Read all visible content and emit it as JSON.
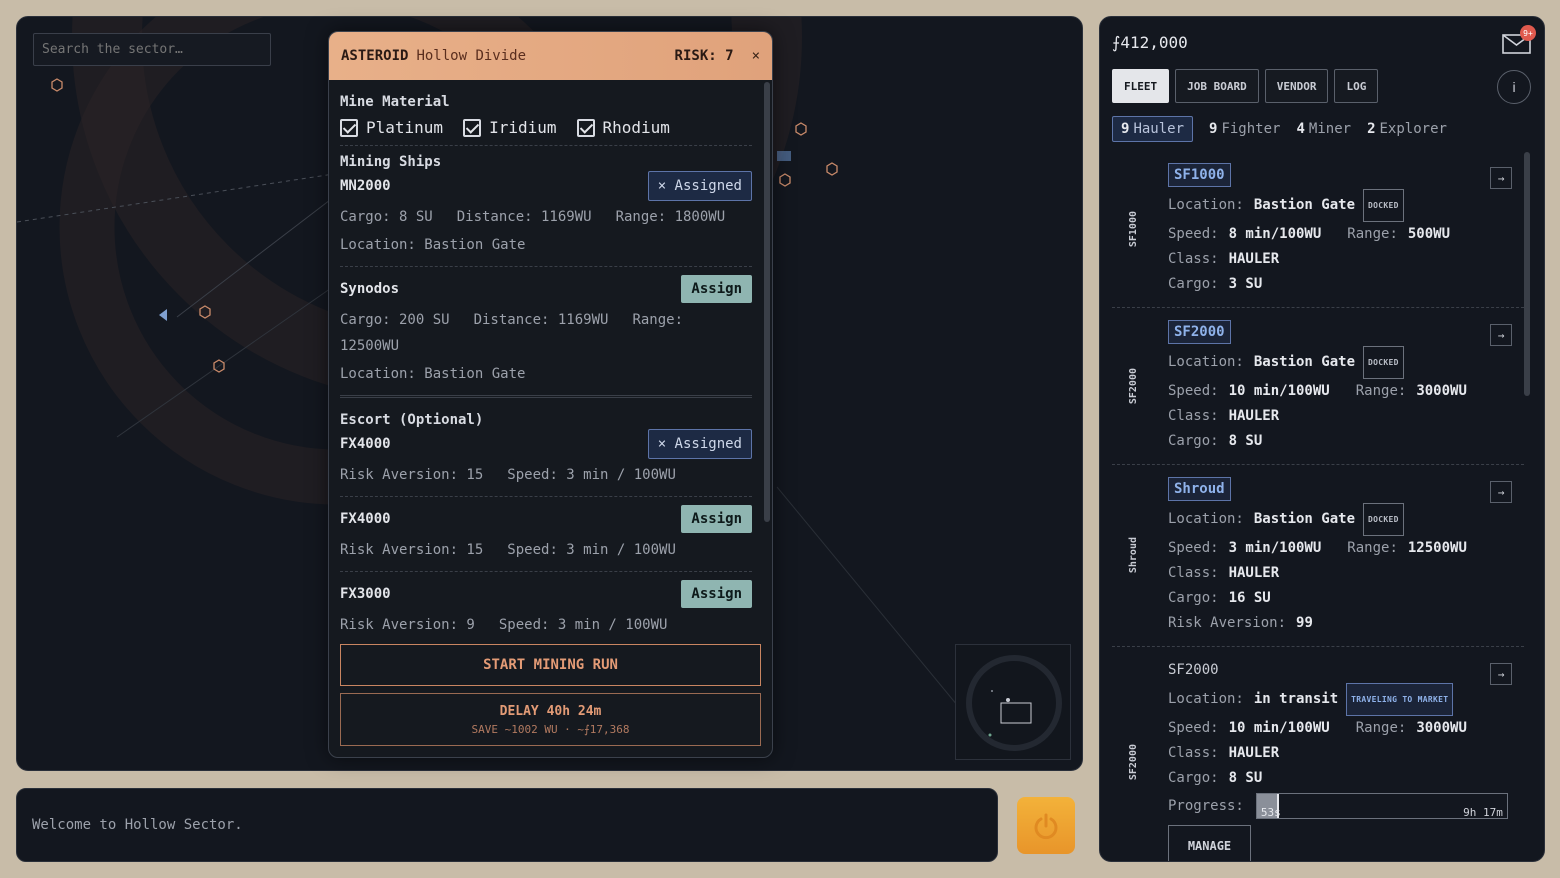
{
  "map": {
    "search_placeholder": "Search the sector…"
  },
  "modal": {
    "kind": "ASTEROID",
    "name": "Hollow Divide",
    "risk_label": "RISK:",
    "risk_value": "7",
    "close_glyph": "×",
    "mine_material_title": "Mine Material",
    "materials": [
      {
        "label": "Platinum",
        "checked": true
      },
      {
        "label": "Iridium",
        "checked": true
      },
      {
        "label": "Rhodium",
        "checked": true
      }
    ],
    "mining_ships_title": "Mining Ships",
    "mining_ships": [
      {
        "name": "MN2000",
        "button": "× Assigned",
        "assigned": true,
        "cargo": "Cargo: 8 SU",
        "distance": "Distance: 1169WU",
        "range": "Range: 1800WU",
        "location": "Location: Bastion Gate"
      },
      {
        "name": "Synodos",
        "button": "Assign",
        "assigned": false,
        "cargo": "Cargo: 200 SU",
        "distance": "Distance: 1169WU",
        "range": "Range: 12500WU",
        "location": "Location: Bastion Gate"
      }
    ],
    "escort_title": "Escort (Optional)",
    "escorts": [
      {
        "name": "FX4000",
        "button": "× Assigned",
        "assigned": true,
        "risk": "Risk Aversion: 15",
        "speed": "Speed: 3 min / 100WU"
      },
      {
        "name": "FX4000",
        "button": "Assign",
        "assigned": false,
        "risk": "Risk Aversion: 15",
        "speed": "Speed: 3 min / 100WU"
      },
      {
        "name": "FX3000",
        "button": "Assign",
        "assigned": false,
        "risk": "Risk Aversion: 9",
        "speed": "Speed: 3 min / 100WU"
      }
    ],
    "start_label": "START MINING RUN",
    "delay_label": "DELAY 40h 24m",
    "delay_sub": "SAVE ~1002 WU · ~⨍17,368"
  },
  "console": {
    "message": "Welcome to Hollow Sector."
  },
  "panel": {
    "credits": "⨍412,000",
    "mail_badge": "9+",
    "tabs": [
      {
        "label": "FLEET",
        "active": true
      },
      {
        "label": "JOB BOARD",
        "active": false
      },
      {
        "label": "VENDOR",
        "active": false
      },
      {
        "label": "LOG",
        "active": false
      }
    ],
    "info_glyph": "i",
    "filters": [
      {
        "count": "9",
        "label": "Hauler",
        "active": true
      },
      {
        "count": "9",
        "label": "Fighter",
        "active": false
      },
      {
        "count": "4",
        "label": "Miner",
        "active": false
      },
      {
        "count": "2",
        "label": "Explorer",
        "active": false
      }
    ],
    "labels": {
      "location": "Location:",
      "speed": "Speed:",
      "range": "Range:",
      "class": "Class:",
      "cargo": "Cargo:",
      "risk": "Risk Aversion:",
      "progress": "Progress:"
    },
    "goto_glyph": "→",
    "ships": [
      {
        "id": "SF1000",
        "location": "Bastion Gate",
        "status": "DOCKED",
        "speed": "8 min/100WU",
        "range": "500WU",
        "class": "HAULER",
        "cargo": "3 SU"
      },
      {
        "id": "SF2000",
        "location": "Bastion Gate",
        "status": "DOCKED",
        "speed": "10 min/100WU",
        "range": "3000WU",
        "class": "HAULER",
        "cargo": "8 SU"
      },
      {
        "id": "Shroud",
        "location": "Bastion Gate",
        "status": "DOCKED",
        "speed": "3 min/100WU",
        "range": "12500WU",
        "class": "HAULER",
        "cargo": "16 SU",
        "risk": "99"
      },
      {
        "id": "SF2000",
        "location": "in transit",
        "status": "TRAVELING TO MARKET",
        "speed": "10 min/100WU",
        "range": "3000WU",
        "class": "HAULER",
        "cargo": "8 SU",
        "progress_left": "53s",
        "progress_right": "9h 17m",
        "progress_fraction": 0.09,
        "manage": "MANAGE"
      }
    ]
  },
  "colors": {
    "accent_orange": "#e39b76",
    "accent_blue": "#8fb2ea",
    "assign_teal": "#8fb5b1",
    "power_amber": "#f3b23a"
  }
}
